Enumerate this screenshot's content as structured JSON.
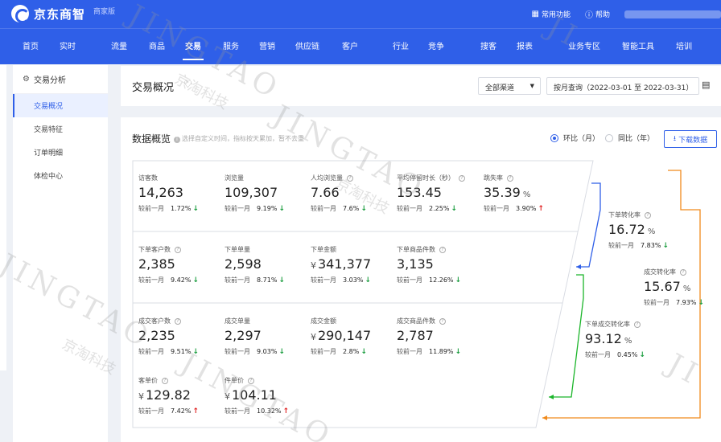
{
  "header": {
    "logo_text": "京东商智",
    "logo_sub": "商家版",
    "common_functions": "常用功能",
    "help": "帮助"
  },
  "nav": [
    "首页",
    "实时",
    "流量",
    "商品",
    "交易",
    "服务",
    "营销",
    "供应链",
    "客户",
    "行业",
    "竞争",
    "搜客",
    "报表",
    "业务专区",
    "智能工具",
    "培训"
  ],
  "nav_active": "交易",
  "sidebar": {
    "head": "交易分析",
    "items": [
      "交易概况",
      "交易特征",
      "订单明细",
      "体检中心"
    ],
    "active": "交易概况"
  },
  "page": {
    "title": "交易概况",
    "channel": "全部渠道",
    "date_range": "按月查询（2022-03-01 至 2022-03-31）"
  },
  "overview": {
    "title": "数据概览",
    "hint": "选择自定义时间，指标按天累加，暂不去重",
    "radio_mom": "环比（月）",
    "radio_yoy": "同比（年）",
    "download": "下载数据",
    "compare_label": "较前一月"
  },
  "metrics": [
    {
      "label": "访客数",
      "value": "14,263",
      "change": "1.72%",
      "dir": "down",
      "help": false
    },
    {
      "label": "浏览量",
      "value": "109,307",
      "change": "9.19%",
      "dir": "down",
      "help": false
    },
    {
      "label": "人均浏览量",
      "value": "7.66",
      "change": "7.6%",
      "dir": "down",
      "help": true
    },
    {
      "label": "平均停留时长（秒）",
      "value": "153.45",
      "change": "2.25%",
      "dir": "down",
      "help": true
    },
    {
      "label": "跳失率",
      "value": "35.39",
      "unit": "%",
      "change": "3.90%",
      "dir": "up",
      "help": true
    },
    {
      "label": "下单客户数",
      "value": "2,385",
      "change": "9.42%",
      "dir": "down",
      "help": true
    },
    {
      "label": "下单单量",
      "value": "2,598",
      "change": "8.71%",
      "dir": "down",
      "help": false
    },
    {
      "label": "下单金额",
      "value": "341,377",
      "currency": "¥",
      "change": "3.03%",
      "dir": "down",
      "help": false
    },
    {
      "label": "下单商品件数",
      "value": "3,135",
      "change": "12.26%",
      "dir": "down",
      "help": true
    },
    {
      "label": "成交客户数",
      "value": "2,235",
      "change": "9.51%",
      "dir": "down",
      "help": true
    },
    {
      "label": "成交单量",
      "value": "2,297",
      "change": "9.03%",
      "dir": "down",
      "help": false
    },
    {
      "label": "成交金额",
      "value": "290,147",
      "currency": "¥",
      "change": "2.8%",
      "dir": "down",
      "help": false
    },
    {
      "label": "成交商品件数",
      "value": "2,787",
      "change": "11.89%",
      "dir": "down",
      "help": true
    },
    {
      "label": "客单价",
      "value": "129.82",
      "currency": "¥",
      "change": "7.42%",
      "dir": "up",
      "help": true
    },
    {
      "label": "件单价",
      "value": "104.11",
      "currency": "¥",
      "change": "10.32%",
      "dir": "up",
      "help": true
    },
    {
      "label": "下单转化率",
      "value": "16.72",
      "unit": "%",
      "change": "7.83%",
      "dir": "down",
      "help": true
    },
    {
      "label": "成交转化率",
      "value": "15.67",
      "unit": "%",
      "change": "7.93%",
      "dir": "down",
      "help": true
    },
    {
      "label": "下单成交转化率",
      "value": "93.12",
      "unit": "%",
      "change": "0.45%",
      "dir": "down",
      "help": true
    }
  ],
  "watermark": {
    "brand": "JINGTAO",
    "company": "京淘科技"
  },
  "colors": {
    "primary": "#2f5fe8",
    "down": "#1a9d3f",
    "up": "#e02020",
    "flow_blue": "#2f5fe8",
    "flow_green": "#1bb52a",
    "flow_orange": "#f08a1c"
  }
}
